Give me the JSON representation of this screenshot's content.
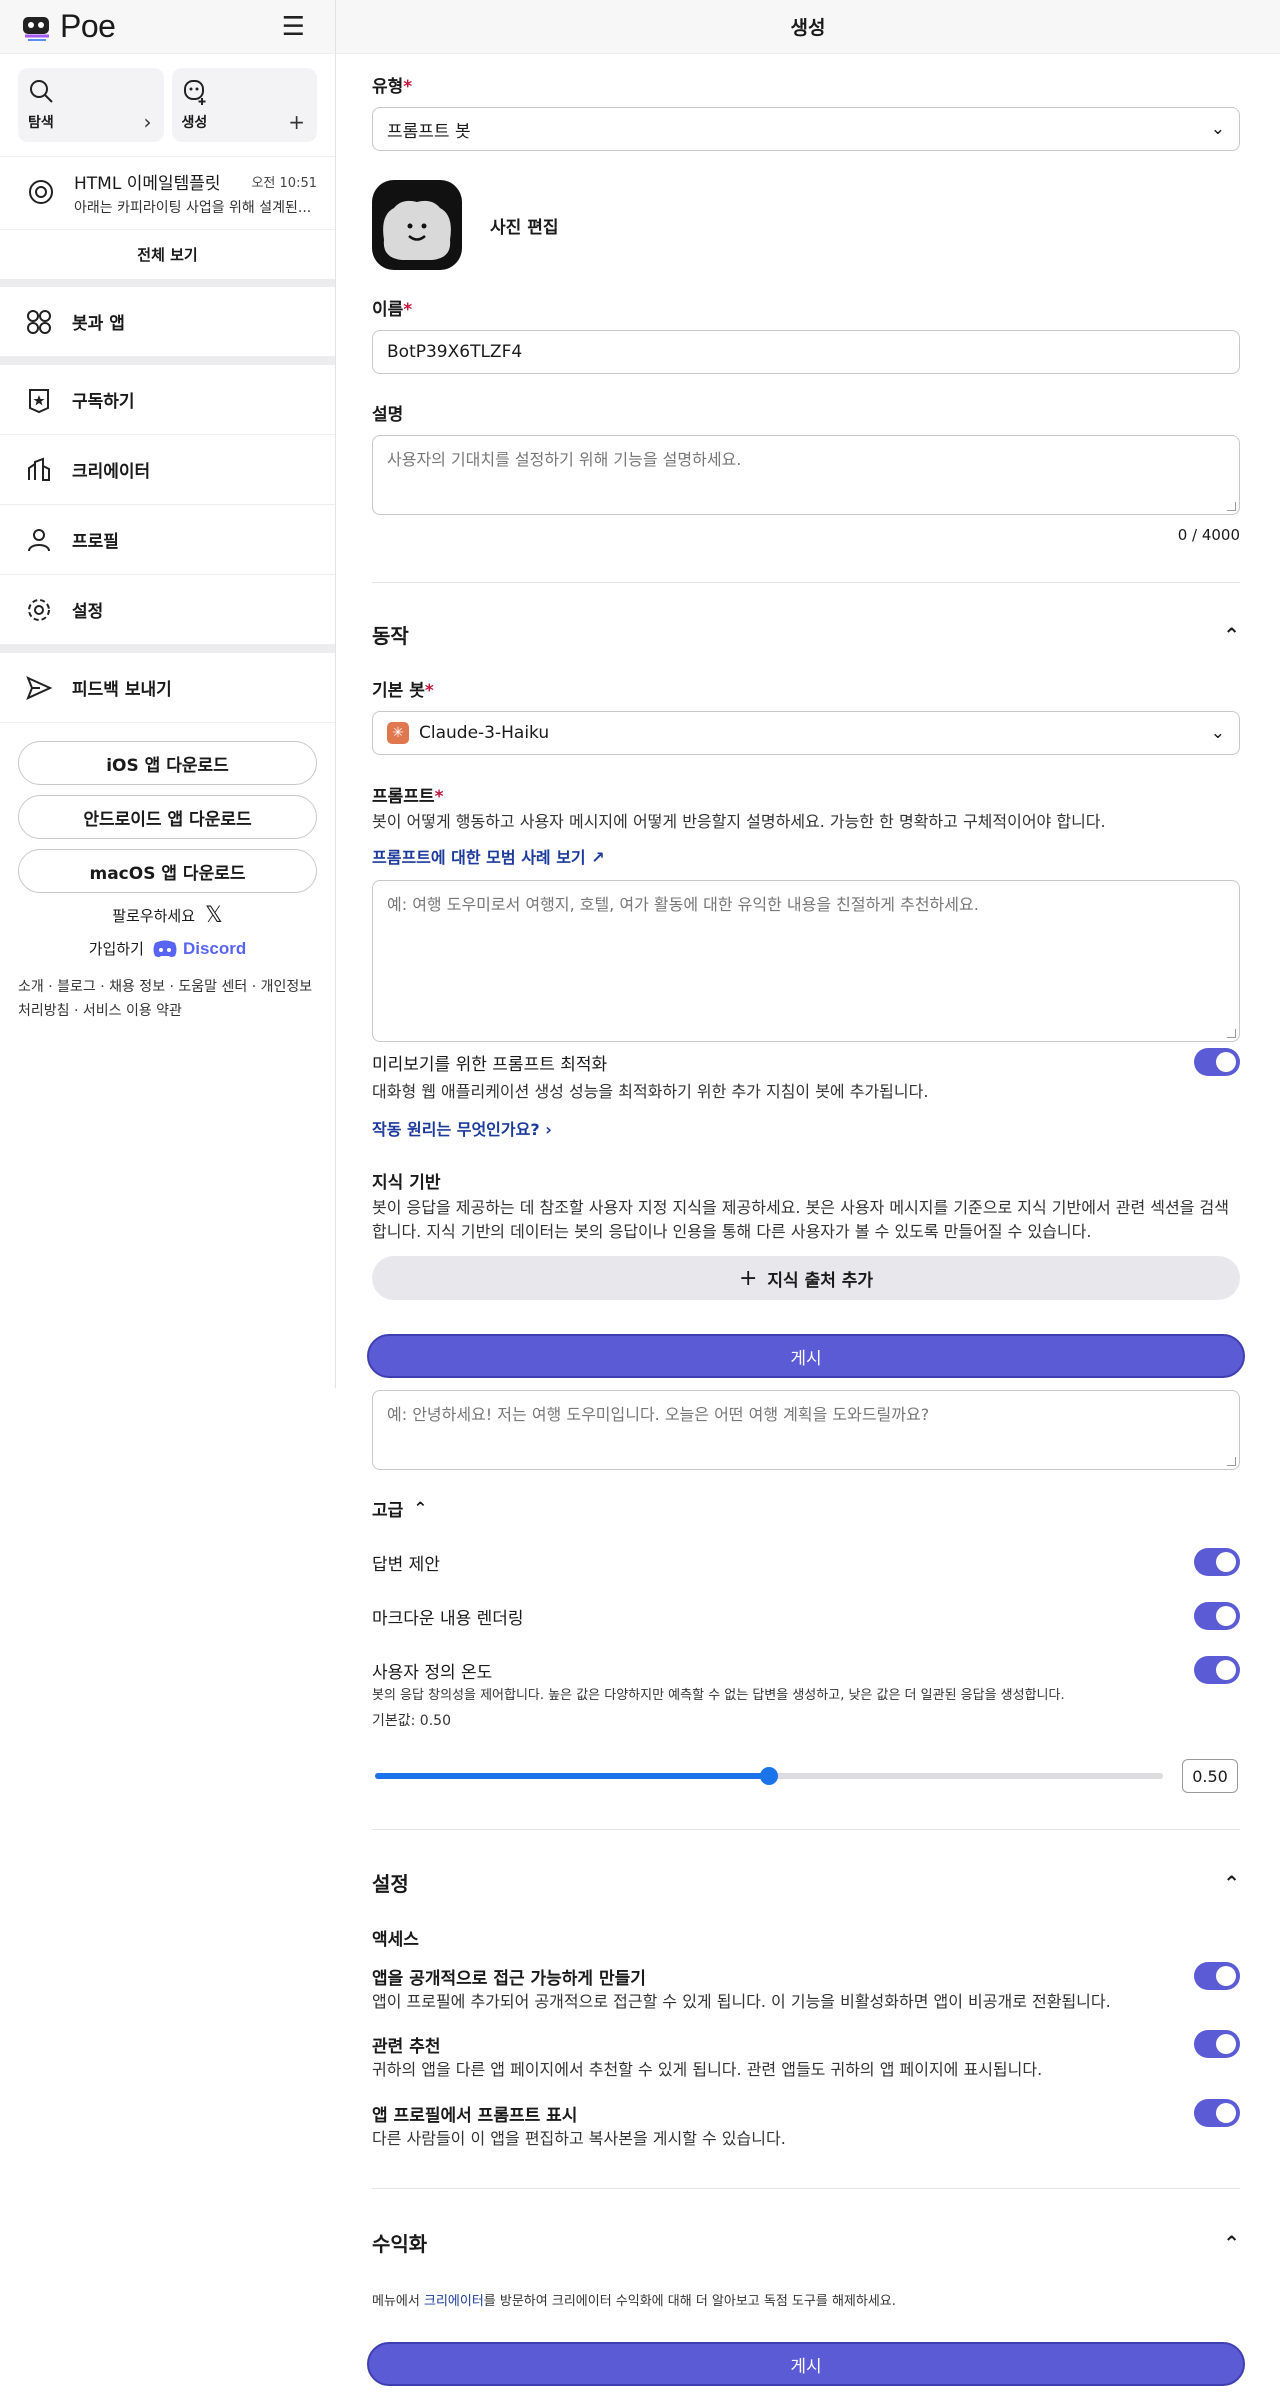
{
  "sidebar": {
    "logo": "Poe",
    "quick": [
      {
        "label": "탐색",
        "icon": "search-icon",
        "action": "chevron-right-icon"
      },
      {
        "label": "생성",
        "icon": "create-bot-icon",
        "action": "plus-icon"
      }
    ],
    "recent": {
      "name": "HTML 이메일템플릿",
      "time": "오전 10:51",
      "snippet": "아래는 카피라이팅 사업을 위해 설계된..."
    },
    "view_all": "전체 보기",
    "nav": [
      {
        "label": "봇과 앱",
        "icon": "bots-apps-icon"
      },
      {
        "label": "구독하기",
        "icon": "subscribe-star-icon"
      },
      {
        "label": "크리에이터",
        "icon": "creator-icon"
      },
      {
        "label": "프로필",
        "icon": "profile-icon"
      },
      {
        "label": "설정",
        "icon": "gear-icon"
      },
      {
        "label": "피드백 보내기",
        "icon": "send-feedback-icon"
      }
    ],
    "downloads": [
      "iOS 앱 다운로드",
      "안드로이드 앱 다운로드",
      "macOS 앱 다운로드"
    ],
    "follow": "팔로우하세요",
    "join": "가입하기",
    "discord": "Discord",
    "footer_links": "소개 · 블로그 · 채용 정보 · 도움말 센터 · 개인정보 처리방침 · 서비스 이용 약관"
  },
  "main": {
    "header_title": "생성",
    "type_label": "유형",
    "type_value": "프롬프트 봇",
    "edit_photo": "사진 편집",
    "name_label": "이름",
    "name_value": "BotP39X6TLZF4",
    "desc_label": "설명",
    "desc_placeholder": "사용자의 기대치를 설정하기 위해 기능을 설명하세요.",
    "desc_count": "0 / 4000",
    "behavior_title": "동작",
    "base_bot_label": "기본 봇",
    "base_bot_value": "Claude-3-Haiku",
    "prompt_label": "프롬프트",
    "prompt_help": "봇이 어떻게 행동하고 사용자 메시지에 어떻게 반응할지 설명하세요. 가능한 한 명확하고 구체적이어야 합니다.",
    "prompt_example_link": "프롬프트에 대한 모범 사례 보기",
    "prompt_placeholder": "예: 여행 도우미로서 여행지, 호텔, 여가 활동에 대한 유익한 내용을 친절하게 추천하세요.",
    "optimize_label": "미리보기를 위한 프롬프트 최적화",
    "optimize_desc": "대화형 웹 애플리케이션 생성 성능을 최적화하기 위한 추가 지침이 봇에 추가됩니다.",
    "how_it_works": "작동 원리는 무엇인가요?",
    "kb_label": "지식 기반",
    "kb_desc": "봇이 응답을 제공하는 데 참조할 사용자 지정 지식을 제공하세요. 봇은 사용자 메시지를 기준으로 지식 기반에서 관련 섹션을 검색합니다. 지식 기반의 데이터는 봇의 응답이나 인용을 통해 다른 사용자가 볼 수 있도록 만들어질 수 있습니다.",
    "add_source": "지식 출처 추가",
    "publish": "게시",
    "greeting_placeholder": "예: 안녕하세요! 저는 여행 도우미입니다. 오늘은 어떤 여행 계획을 도와드릴까요?",
    "advanced_label": "고급",
    "suggest_replies": "답변 제안",
    "markdown_render": "마크다운 내용 렌더링",
    "custom_temp": "사용자 정의 온도",
    "temp_desc": "봇의 응답 창의성을 제어합니다. 높은 값은 다양하지만 예측할 수 없는 답변을 생성하고, 낮은 값은 더 일관된 응답을 생성합니다.",
    "temp_default": "기본값: 0.50",
    "temp_value": "0.50",
    "temp_level": 0.5,
    "settings_title": "설정",
    "access_label": "액세스",
    "public_label": "앱을 공개적으로 접근 가능하게 만들기",
    "public_desc": "앱이 프로필에 추가되어 공개적으로 접근할 수 있게 됩니다. 이 기능을 비활성화하면 앱이 비공개로 전환됩니다.",
    "related_label": "관련 추천",
    "related_desc": "귀하의 앱을 다른 앱 페이지에서 추천할 수 있게 됩니다. 관련 앱들도 귀하의 앱 페이지에 표시됩니다.",
    "show_prompt_label": "앱 프로필에서 프롬프트 표시",
    "show_prompt_desc": "다른 사람들이 이 앱을 편집하고 복사본을 게시할 수 있습니다.",
    "monetize_title": "수익화",
    "monetize_pre": "메뉴에서 ",
    "monetize_link": "크리에이터",
    "monetize_post": "를 방문하여 크리에이터 수익화에 대해 더 알아보고 독점 도구를 해제하세요."
  },
  "colors": {
    "accent": "#5b5bd6",
    "link": "#1b3a9b",
    "required": "#c0163b",
    "slider": "#1a73e8"
  }
}
